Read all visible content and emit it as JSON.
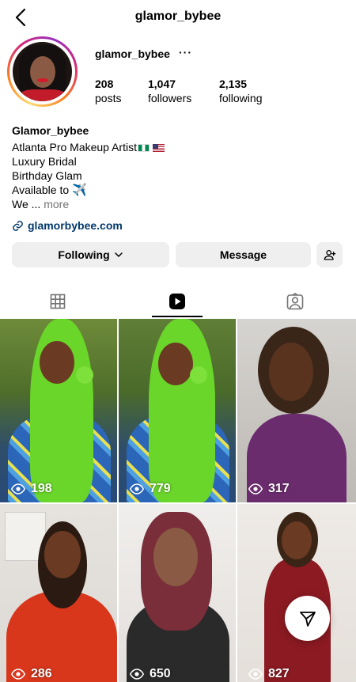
{
  "header": {
    "username": "glamor_bybee"
  },
  "profile": {
    "name": "glamor_bybee",
    "more_label": "···",
    "stats": [
      {
        "value": "208",
        "label": "posts"
      },
      {
        "value": "1,047",
        "label": "followers"
      },
      {
        "value": "2,135",
        "label": "following"
      }
    ]
  },
  "bio": {
    "display_name": "Glamor_bybee",
    "lines": [
      "Atlanta Pro Makeup Artist",
      "Luxury Bridal",
      "Birthday Glam",
      "Available to ",
      "We ... "
    ],
    "plane_emoji": "✈️",
    "more_text": "more",
    "link": "glamorbybee.com"
  },
  "buttons": {
    "following": "Following",
    "message": "Message"
  },
  "tabs": [
    {
      "name": "grid",
      "icon": "grid-icon"
    },
    {
      "name": "reels",
      "icon": "reels-icon",
      "active": true
    },
    {
      "name": "tagged",
      "icon": "tagged-icon"
    }
  ],
  "reels": [
    {
      "views": "198"
    },
    {
      "views": "779"
    },
    {
      "views": "317"
    },
    {
      "views": "286"
    },
    {
      "views": "650"
    },
    {
      "views": "827"
    }
  ],
  "fab": {
    "icon": "send-icon"
  },
  "colors": {
    "link": "#00376b",
    "button_bg": "#efefef",
    "secondary_text": "#737373"
  }
}
